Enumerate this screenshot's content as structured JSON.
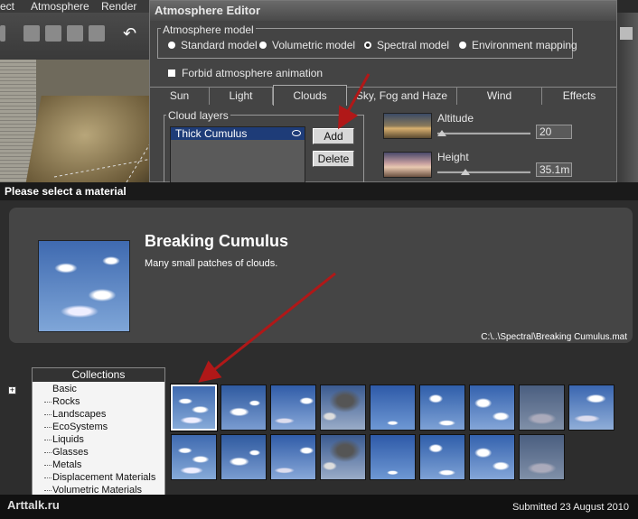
{
  "menubar": {
    "items": [
      "ect",
      "Atmosphere",
      "Render"
    ]
  },
  "atmosphere_editor": {
    "title": "Atmosphere Editor",
    "model_group_label": "Atmosphere model",
    "models": [
      "Standard model",
      "Volumetric model",
      "Spectral model",
      "Environment mapping"
    ],
    "selected_model": "Spectral model",
    "forbid_label": "Forbid atmosphere animation",
    "tabs": [
      "Sun",
      "Light",
      "Clouds",
      "Sky, Fog and Haze",
      "Wind",
      "Effects"
    ],
    "active_tab": "Clouds",
    "cloud_layers_label": "Cloud layers",
    "cloud_layers": [
      "Thick Cumulus"
    ],
    "add_label": "Add",
    "delete_label": "Delete",
    "altitude_label": "Altitude",
    "altitude_value": "20",
    "altitude_slider": 0.05,
    "height_label": "Height",
    "height_value": "35.1m",
    "height_slider": 0.3
  },
  "material_dialog": {
    "title": "Please select a material",
    "material_name": "Breaking Cumulus",
    "material_description": "Many small patches of clouds.",
    "material_path": "C:\\..\\Spectral\\Breaking Cumulus.mat",
    "collections_header": "Collections",
    "collections": [
      "Basic",
      "Rocks",
      "Landscapes",
      "EcoSystems",
      "Liquids",
      "Glasses",
      "Metals",
      "Displacement Materials",
      "Volumetric Materials"
    ],
    "thumbnail_count": 17,
    "selected_thumbnail": 0
  },
  "footer": {
    "logo": "Arttalk.ru",
    "submitted": "Submitted 23 August 2010"
  },
  "colors": {
    "arrow": "#b01818",
    "selection": "#1e3c78"
  }
}
